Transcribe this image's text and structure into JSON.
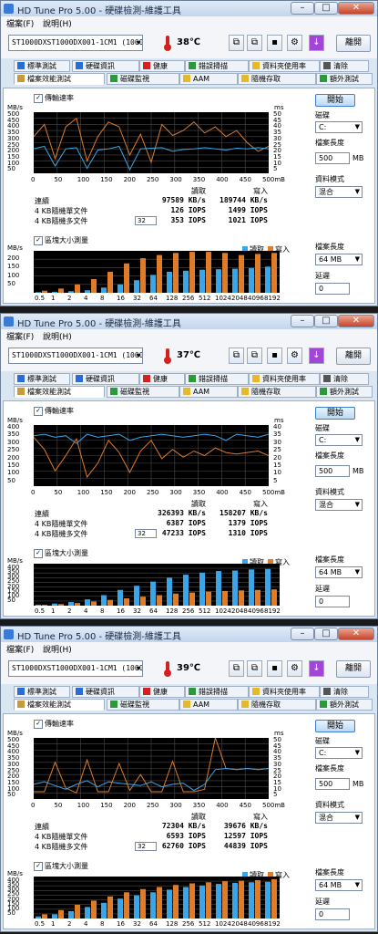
{
  "app": {
    "title": "HD Tune Pro  5.00 - 硬碟檢測-維護工具",
    "menu": [
      "檔案(F)",
      "說明(H)"
    ],
    "exit_label": "離開",
    "drive": "ST1000DXST1000DX001-1CM1 (1000 gB)",
    "tabs_row1": [
      "標準測試",
      "硬碟資訊",
      "健康",
      "錯誤掃描",
      "資料夾使用率",
      "清除"
    ],
    "tabs_row2": [
      "檔案效能測試",
      "磁碟監視",
      "AAM",
      "隨機存取",
      "額外測試"
    ],
    "colors": {
      "read": "#3aa6e8",
      "write": "#e07b28",
      "accent": "#3c7fd0"
    }
  },
  "labels": {
    "transfer_rate": "傳輸速率",
    "block_size": "區塊大小測量",
    "mbs": "MB/s",
    "ms": "ms",
    "read": "讀取",
    "write": "寫入",
    "seq": "連續",
    "rand_single": "4 KB隨機單文件",
    "rand_multi": "4 KB隨機多文件",
    "qd": "32",
    "start": "開始",
    "drive": "磁碟",
    "drive_value": "C:",
    "file_length": "檔案長度",
    "file_length_value": "500",
    "mb": "MB",
    "data_mode": "資料模式",
    "data_mode_value": "混合",
    "file_length2": "檔案長度",
    "file_length2_value": "64 MB",
    "delay": "延遲",
    "delay_value": "0"
  },
  "axes": {
    "x_ticks": [
      "0",
      "50",
      "100",
      "150",
      "200",
      "250",
      "300",
      "350",
      "400",
      "450",
      "500mB"
    ],
    "block_ticks": [
      "0.5",
      "1",
      "2",
      "4",
      "8",
      "16",
      "32",
      "64",
      "128",
      "256",
      "512",
      "1024",
      "2048",
      "4096",
      "8192"
    ]
  },
  "panels": [
    {
      "temperature": "38℃",
      "seq_read": "97589 KB/s",
      "seq_write": "189744 KB/s",
      "single_read": "126 IOPS",
      "single_write": "1499 IOPS",
      "multi_read": "353 IOPS",
      "multi_write": "1021 IOPS",
      "y_left": [
        "500",
        "450",
        "400",
        "350",
        "300",
        "250",
        "200",
        "150",
        "100",
        "50"
      ],
      "y_right": [
        "50",
        "45",
        "40",
        "35",
        "30",
        "25",
        "20",
        "15",
        "10",
        "5"
      ],
      "block_y": [
        "200",
        "150",
        "100",
        "50"
      ]
    },
    {
      "temperature": "37℃",
      "seq_read": "326393 KB/s",
      "seq_write": "158207 KB/s",
      "single_read": "6387 IOPS",
      "single_write": "1379 IOPS",
      "multi_read": "47233 IOPS",
      "multi_write": "1310 IOPS",
      "y_left": [
        "400",
        "350",
        "300",
        "250",
        "200",
        "150",
        "100",
        "50"
      ],
      "y_right": [
        "40",
        "35",
        "30",
        "25",
        "20",
        "15",
        "10",
        "5"
      ],
      "block_y": [
        "400",
        "350",
        "300",
        "250",
        "200",
        "150",
        "100",
        "50"
      ]
    },
    {
      "temperature": "39℃",
      "seq_read": "72304 KB/s",
      "seq_write": "39676 KB/s",
      "single_read": "6593 IOPS",
      "single_write": "12597 IOPS",
      "multi_read": "62760 IOPS",
      "multi_write": "44839 IOPS",
      "y_left": [
        "500",
        "450",
        "400",
        "350",
        "300",
        "250",
        "200",
        "150",
        "100",
        "50"
      ],
      "y_right": [
        "50",
        "45",
        "40",
        "35",
        "30",
        "25",
        "20",
        "15",
        "10",
        "5"
      ],
      "block_y": [
        "400",
        "350",
        "300",
        "250",
        "200",
        "150",
        "100",
        "50"
      ]
    }
  ],
  "chart_data": [
    {
      "type": "bar",
      "categories": [
        "0.5",
        "1",
        "2",
        "4",
        "8",
        "16",
        "32",
        "64",
        "128",
        "256",
        "512",
        "1024",
        "2048",
        "4096",
        "8192"
      ],
      "series": [
        {
          "name": "讀取",
          "values": [
            3,
            5,
            8,
            12,
            25,
            40,
            60,
            85,
            100,
            105,
            110,
            112,
            115,
            118,
            125
          ]
        },
        {
          "name": "寫入",
          "values": [
            10,
            20,
            40,
            65,
            100,
            140,
            165,
            180,
            190,
            195,
            195,
            190,
            180,
            185,
            190
          ]
        }
      ],
      "ylim": [
        0,
        200
      ]
    },
    {
      "type": "bar",
      "categories": [
        "0.5",
        "1",
        "2",
        "4",
        "8",
        "16",
        "32",
        "64",
        "128",
        "256",
        "512",
        "1024",
        "2048",
        "4096",
        "8192"
      ],
      "series": [
        {
          "name": "讀取",
          "values": [
            10,
            20,
            35,
            60,
            100,
            150,
            190,
            230,
            265,
            295,
            315,
            330,
            335,
            345,
            350
          ]
        },
        {
          "name": "寫入",
          "values": [
            8,
            15,
            25,
            40,
            55,
            70,
            85,
            100,
            115,
            125,
            135,
            140,
            145,
            150,
            155
          ]
        }
      ],
      "ylim": [
        0,
        400
      ]
    },
    {
      "type": "bar",
      "categories": [
        "0.5",
        "1",
        "2",
        "4",
        "8",
        "16",
        "32",
        "64",
        "128",
        "256",
        "512",
        "1024",
        "2048",
        "4096",
        "8192"
      ],
      "series": [
        {
          "name": "讀取",
          "values": [
            20,
            40,
            70,
            110,
            150,
            190,
            220,
            250,
            275,
            300,
            315,
            330,
            340,
            345,
            350
          ]
        },
        {
          "name": "寫入",
          "values": [
            40,
            80,
            130,
            170,
            210,
            250,
            280,
            300,
            320,
            335,
            345,
            355,
            360,
            365,
            375
          ]
        }
      ],
      "ylim": [
        0,
        400
      ]
    }
  ]
}
